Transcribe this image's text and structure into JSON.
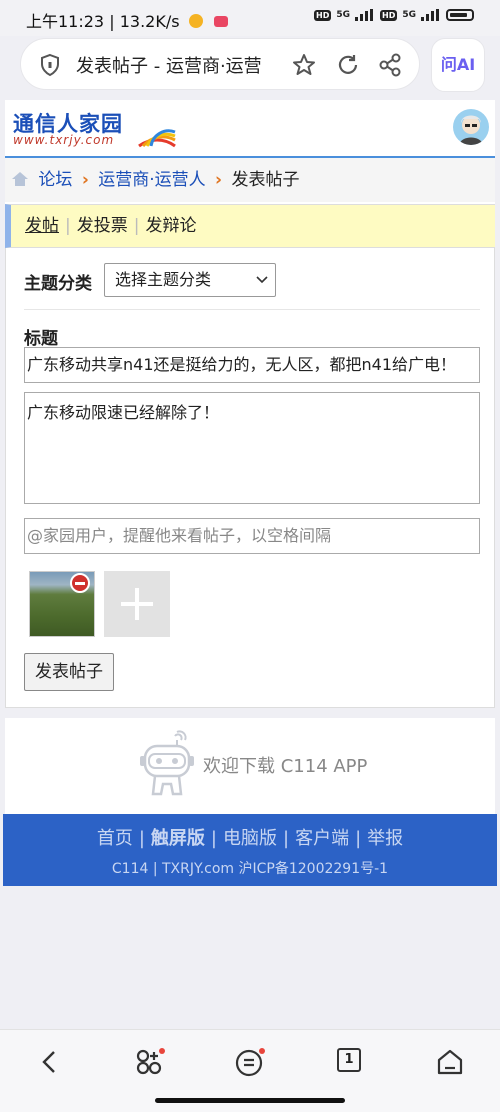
{
  "status_bar": {
    "time": "上午11:23",
    "speed": "13.2K/s",
    "hd1": "HD",
    "net1": "5G",
    "hd2": "HD",
    "net2": "5G"
  },
  "browser": {
    "url_title": "发表帖子 - 运营商·运营",
    "ai_label": "问AI"
  },
  "header": {
    "logo_text": "通信人家园",
    "logo_url": "www.txrjy.com"
  },
  "breadcrumb": {
    "items": [
      "论坛",
      "运营商·运营人"
    ],
    "current": "发表帖子"
  },
  "tabs": [
    "发帖",
    "发投票",
    "发辩论"
  ],
  "form": {
    "category_label": "主题分类",
    "category_value": "选择主题分类",
    "title_label": "标题",
    "title_value": "广东移动共享n41还是挺给力的，无人区，都把n41给广电！",
    "content_value": "广东移动限速已经解除了！",
    "mention_placeholder": "@家园用户，提醒他来看帖子，以空格间隔",
    "submit_label": "发表帖子"
  },
  "app_banner": {
    "text": "欢迎下载 C114 APP"
  },
  "footer": {
    "links": [
      "首页",
      "触屏版",
      "电脑版",
      "客户端",
      "举报"
    ],
    "current": "触屏版",
    "copyright": "C114 | TXRJY.com 沪ICP备12002291号-1"
  },
  "bottom_nav": {
    "tab_count": "1"
  },
  "colors": {
    "brand_blue": "#1b4fb8",
    "footer_blue": "#2c62c6",
    "tab_bg": "#fefbc2",
    "crumb_sep": "#e0741f"
  }
}
